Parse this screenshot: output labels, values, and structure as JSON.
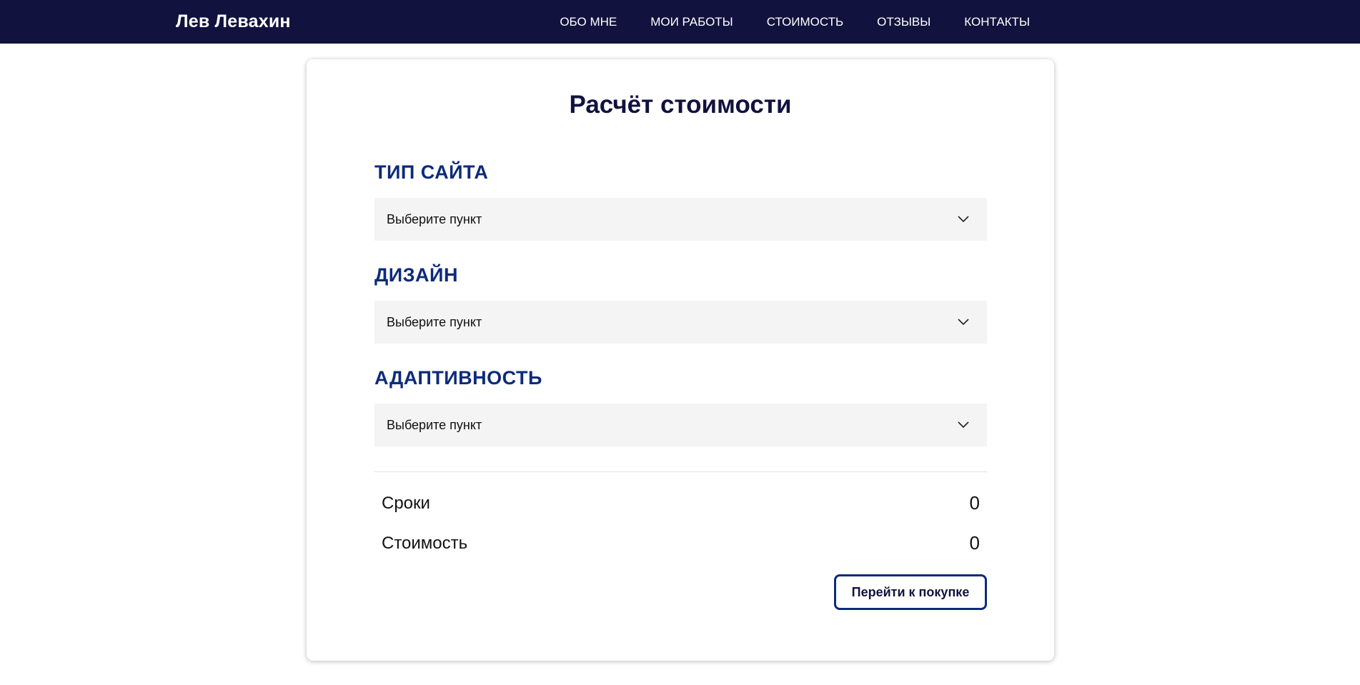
{
  "header": {
    "brand": "Лев Левахин",
    "nav": [
      {
        "label": "ОБО МНЕ"
      },
      {
        "label": "МОИ РАБОТЫ"
      },
      {
        "label": "СТОИМОСТЬ"
      },
      {
        "label": "ОТЗЫВЫ"
      },
      {
        "label": "КОНТАКТЫ"
      }
    ]
  },
  "calculator": {
    "title": "Расчёт стоимости",
    "fields": [
      {
        "label": "ТИП САЙТА",
        "selected": "Выберите пункт"
      },
      {
        "label": "ДИЗАЙН",
        "selected": "Выберите пункт"
      },
      {
        "label": "АДАПТИВНОСТЬ",
        "selected": "Выберите пункт"
      }
    ],
    "summary": {
      "terms_label": "Сроки",
      "terms_value": "0",
      "price_label": "Стоимость",
      "price_value": "0"
    },
    "buy_label": "Перейти к покупке"
  },
  "colors": {
    "navbar_bg": "#12123f",
    "label_blue": "#0d2b7a",
    "select_bg": "#f4f4f4"
  },
  "icons": {
    "select_icon": "chevron-down-icon"
  }
}
